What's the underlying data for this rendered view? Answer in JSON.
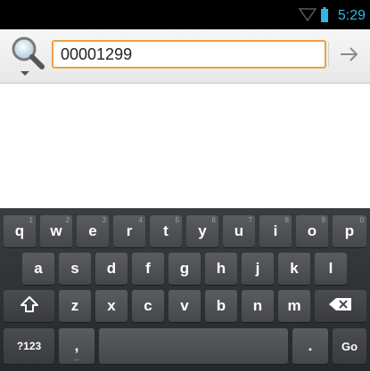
{
  "status_bar": {
    "time": "5:29",
    "accent": "#33b5e5",
    "icons": [
      "wifi-icon",
      "battery-icon"
    ]
  },
  "search": {
    "value": "00001299",
    "border_color": "#f0a140",
    "icons": [
      "search-icon",
      "dropdown-triangle-icon",
      "go-arrow-icon"
    ]
  },
  "keyboard": {
    "row1": [
      {
        "label": "q",
        "hint": "1"
      },
      {
        "label": "w",
        "hint": "2"
      },
      {
        "label": "e",
        "hint": "3"
      },
      {
        "label": "r",
        "hint": "4"
      },
      {
        "label": "t",
        "hint": "5"
      },
      {
        "label": "y",
        "hint": "6"
      },
      {
        "label": "u",
        "hint": "7"
      },
      {
        "label": "i",
        "hint": "8"
      },
      {
        "label": "o",
        "hint": "9"
      },
      {
        "label": "p",
        "hint": "0"
      }
    ],
    "row2": [
      "a",
      "s",
      "d",
      "f",
      "g",
      "h",
      "j",
      "k",
      "l"
    ],
    "row3": [
      "z",
      "x",
      "c",
      "v",
      "b",
      "n",
      "m"
    ],
    "shift_icon": "shift-arrow-icon",
    "delete_icon": "backspace-icon",
    "symbols_label": "?123",
    "comma_label": ",",
    "comma_sub": "_",
    "period_label": ".",
    "go_label": "Go"
  }
}
